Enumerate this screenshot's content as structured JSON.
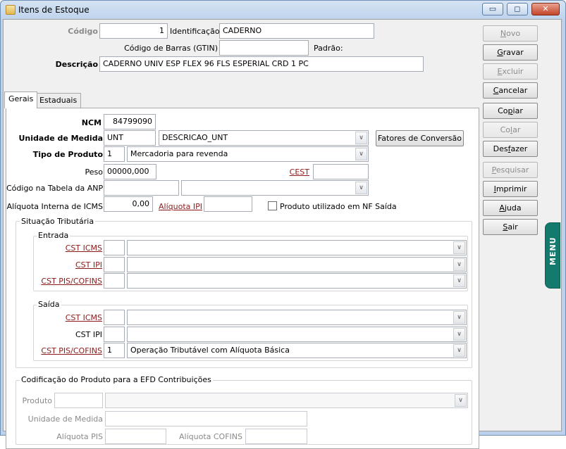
{
  "window": {
    "title": "Itens de Estoque",
    "min_glyph": "▭",
    "max_glyph": "◻",
    "close_glyph": "✕"
  },
  "header": {
    "codigo_label": "Código",
    "codigo_value": "1",
    "identificacao_label": "Identificação",
    "identificacao_value": "CADERNO",
    "barcode_label": "Código de Barras (GTIN)",
    "barcode_value": "",
    "padrao_label": "Padrão:",
    "descricao_label": "Descrição",
    "descricao_value": "CADERNO UNIV ESP FLEX 96 FLS ESPERIAL CRD 1 PC"
  },
  "tabs": [
    {
      "label": "Gerais",
      "active": true
    },
    {
      "label": "Estaduais",
      "active": false
    }
  ],
  "gerais": {
    "ncm_label": "NCM",
    "ncm_value": "84799090",
    "unidade_label": "Unidade de Medida",
    "unidade_code": "UNT",
    "unidade_desc": "DESCRICAO_UNT",
    "fatores_button": "Fatores de Conversão",
    "tipo_label": "Tipo de Produto",
    "tipo_code": "1",
    "tipo_desc": "Mercadoria para revenda",
    "peso_label": "Peso",
    "peso_value": "00000,000",
    "cest_label": "CEST",
    "cest_value": "",
    "anp_label": "Código na Tabela da ANP",
    "anp_code": "",
    "anp_desc": "",
    "icms_label": "Alíquota Interna de ICMS",
    "icms_value": "0,00",
    "ipi_label": "Alíquota IPI",
    "ipi_value": "",
    "nf_saida_label": "Produto utilizado em NF Saída",
    "nf_saida_checked": false
  },
  "situacao": {
    "title": "Situação Tributária",
    "entrada": {
      "title": "Entrada",
      "rows": [
        {
          "label": "CST ICMS",
          "code": "",
          "desc": "",
          "link": true
        },
        {
          "label": "CST IPI",
          "code": "",
          "desc": "",
          "link": true
        },
        {
          "label": "CST PIS/COFINS",
          "code": "",
          "desc": "",
          "link": true
        }
      ]
    },
    "saida": {
      "title": "Saída",
      "rows": [
        {
          "label": "CST ICMS",
          "code": "",
          "desc": "",
          "link": true
        },
        {
          "label": "CST IPI",
          "code": "",
          "desc": "",
          "link": false
        },
        {
          "label": "CST PIS/COFINS",
          "code": "1",
          "desc": "Operação Tributável com Alíquota Básica",
          "link": true
        }
      ]
    }
  },
  "efd": {
    "title": "Codificação do Produto para a EFD Contribuições",
    "produto_label": "Produto",
    "produto_code": "",
    "produto_desc": "",
    "unidade_label": "Unidade de Medida",
    "unidade_value": "",
    "pis_label": "Alíquota PIS",
    "pis_value": "",
    "cofins_label": "Alíquota COFINS",
    "cofins_value": ""
  },
  "actions": [
    {
      "key": "novo",
      "label_pre": "",
      "label_u": "N",
      "label_post": "ovo",
      "enabled": false
    },
    {
      "key": "gravar",
      "label_pre": "",
      "label_u": "G",
      "label_post": "ravar",
      "enabled": true
    },
    {
      "key": "excluir",
      "label_pre": "",
      "label_u": "E",
      "label_post": "xcluir",
      "enabled": false
    },
    {
      "key": "cancelar",
      "label_pre": "",
      "label_u": "C",
      "label_post": "ancelar",
      "enabled": true
    },
    {
      "key": "copiar",
      "label_pre": "Co",
      "label_u": "p",
      "label_post": "iar",
      "enabled": true
    },
    {
      "key": "colar",
      "label_pre": "Co",
      "label_u": "l",
      "label_post": "ar",
      "enabled": false
    },
    {
      "key": "desfazer",
      "label_pre": "Des",
      "label_u": "f",
      "label_post": "azer",
      "enabled": true
    },
    {
      "key": "pesquisar",
      "label_pre": "",
      "label_u": "P",
      "label_post": "esquisar",
      "enabled": false
    },
    {
      "key": "imprimir",
      "label_pre": "",
      "label_u": "I",
      "label_post": "mprimir",
      "enabled": true
    },
    {
      "key": "ajuda",
      "label_pre": "",
      "label_u": "A",
      "label_post": "juda",
      "enabled": true
    },
    {
      "key": "sair",
      "label_pre": "",
      "label_u": "S",
      "label_post": "air",
      "enabled": true
    }
  ],
  "menu_tab": "MENU"
}
